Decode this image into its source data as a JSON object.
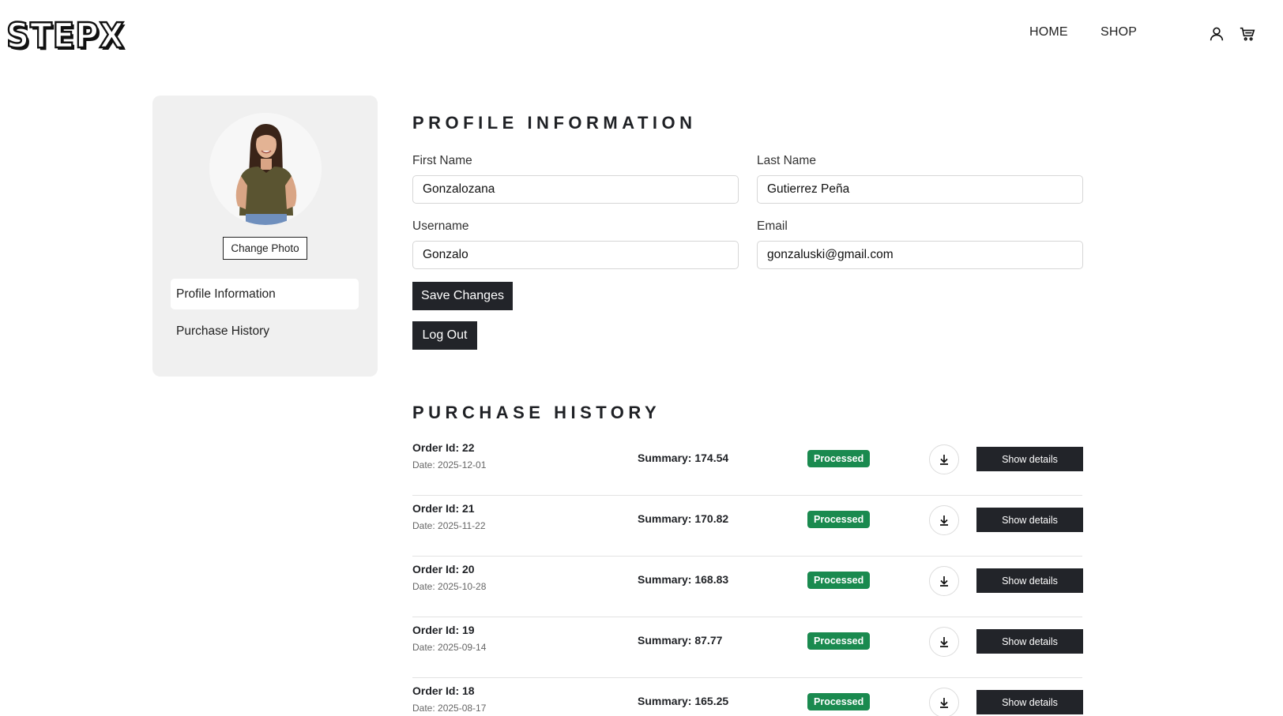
{
  "brand": {
    "logo_text": "STEPX"
  },
  "nav": {
    "home": "HOME",
    "shop": "SHOP"
  },
  "header_icons": [
    "user-icon",
    "cart-icon"
  ],
  "sidebar": {
    "change_photo_label": "Change Photo",
    "items": [
      {
        "label": "Profile Information",
        "active": true
      },
      {
        "label": "Purchase History",
        "active": false
      }
    ]
  },
  "profile": {
    "title": "PROFILE INFORMATION",
    "first_name_label": "First Name",
    "first_name_value": "Gonzalozana",
    "last_name_label": "Last Name",
    "last_name_value": "Gutierrez Peña",
    "username_label": "Username",
    "username_value": "Gonzalo",
    "email_label": "Email",
    "email_value": "gonzaluski@gmail.com",
    "save_label": "Save Changes",
    "logout_label": "Log Out"
  },
  "purchase_history": {
    "title": "PURCHASE HISTORY",
    "details_label": "Show details",
    "orders": [
      {
        "id": "Order Id: 22",
        "date": "Date: 2025-12-01",
        "summary": "Summary: 174.54",
        "status": "Processed"
      },
      {
        "id": "Order Id: 21",
        "date": "Date: 2025-11-22",
        "summary": "Summary: 170.82",
        "status": "Processed"
      },
      {
        "id": "Order Id: 20",
        "date": "Date: 2025-10-28",
        "summary": "Summary: 168.83",
        "status": "Processed"
      },
      {
        "id": "Order Id: 19",
        "date": "Date: 2025-09-14",
        "summary": "Summary: 87.77",
        "status": "Processed"
      },
      {
        "id": "Order Id: 18",
        "date": "Date: 2025-08-17",
        "summary": "Summary: 165.25",
        "status": "Processed"
      }
    ]
  },
  "colors": {
    "dark_button": "#222429",
    "status_green": "#1a8a4f",
    "sidebar_bg": "#f0f0f0"
  }
}
